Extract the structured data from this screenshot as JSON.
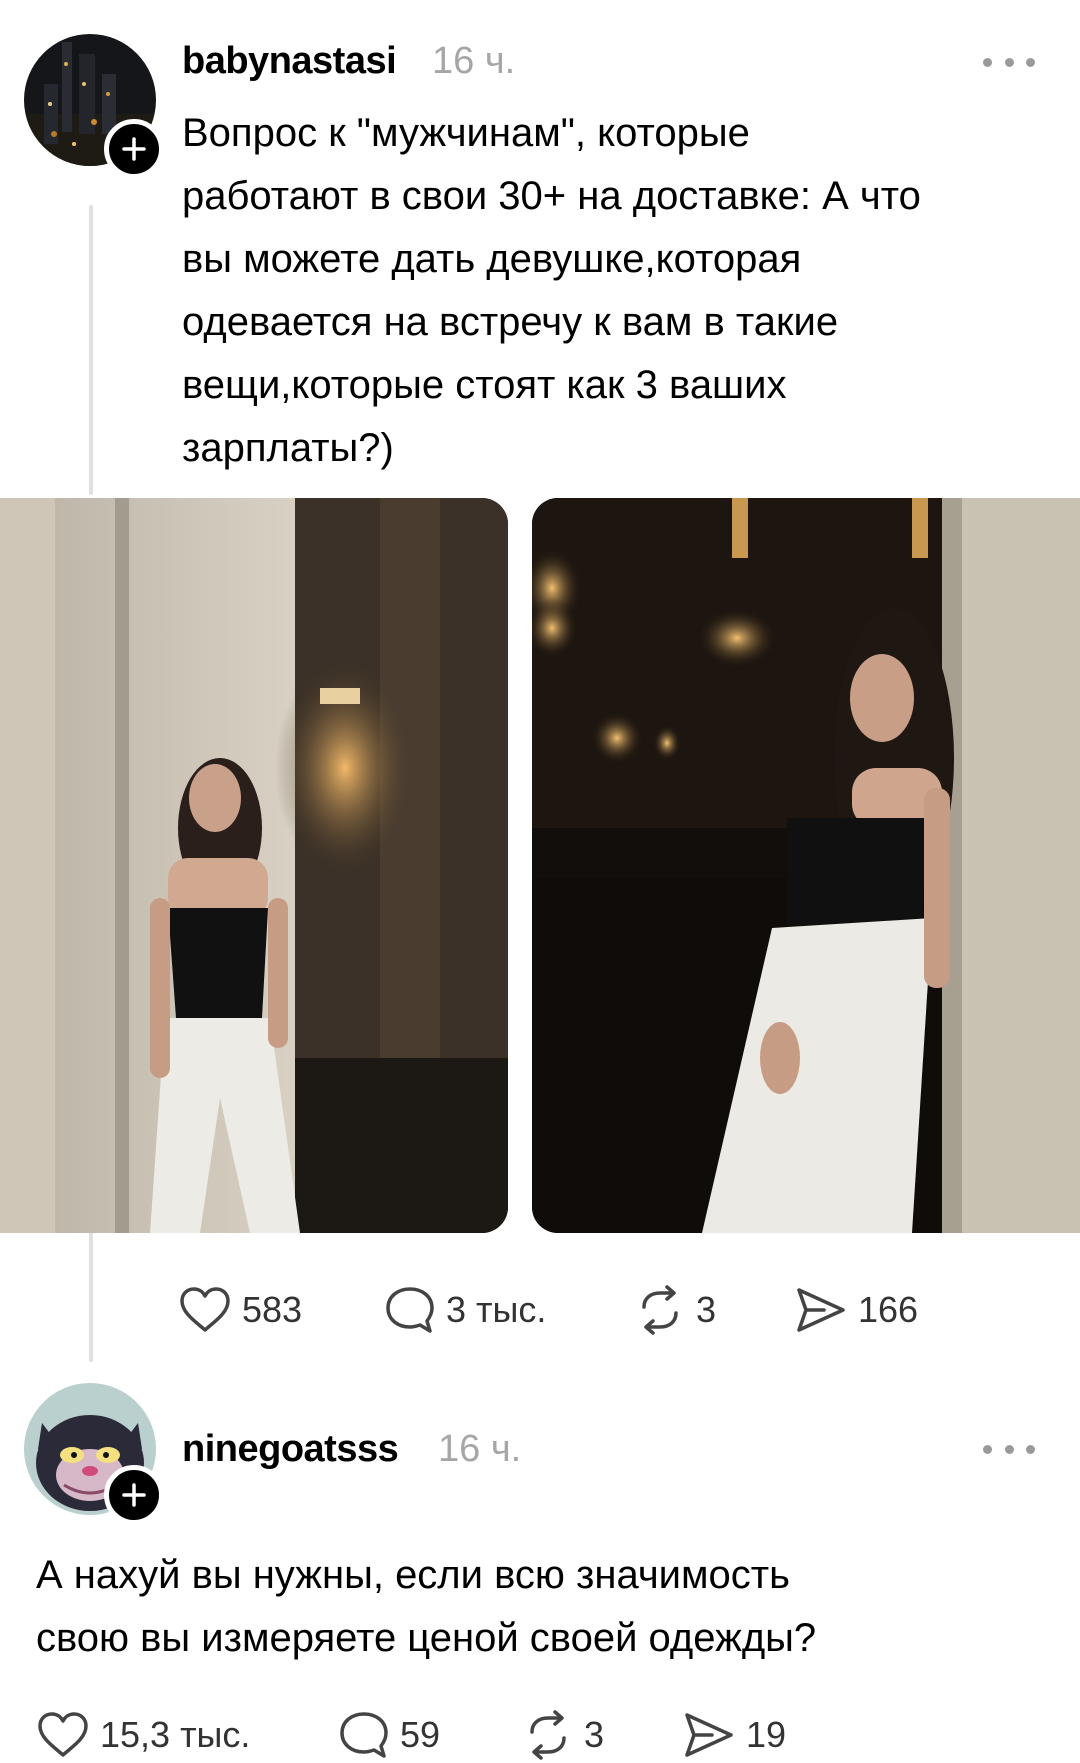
{
  "post": {
    "username": "babynastasi",
    "time": "16 ч.",
    "text": "Вопрос к \"мужчинам\", которые\nработают в свои 30+  на доставке: А что\nвы можете дать девушке,которая\nодевается на встречу к вам в такие\nвещи,которые стоят как 3 ваших\nзарплаты?)",
    "likes": "583",
    "comments": "3 тыс.",
    "reposts": "3",
    "shares": "166"
  },
  "reply": {
    "username": "ninegoatsss",
    "time": "16 ч.",
    "text": "А нахуй вы нужны, если всю значимость\nсвою вы измеряете ценой своей одежды?",
    "likes": "15,3 тыс.",
    "comments": "59",
    "reposts": "3",
    "shares": "19"
  },
  "icons": {
    "more": "more-horizontal-icon",
    "follow": "plus-icon",
    "like": "heart-icon",
    "comment": "comment-bubble-icon",
    "repost": "repost-arrows-icon",
    "share": "send-icon"
  }
}
